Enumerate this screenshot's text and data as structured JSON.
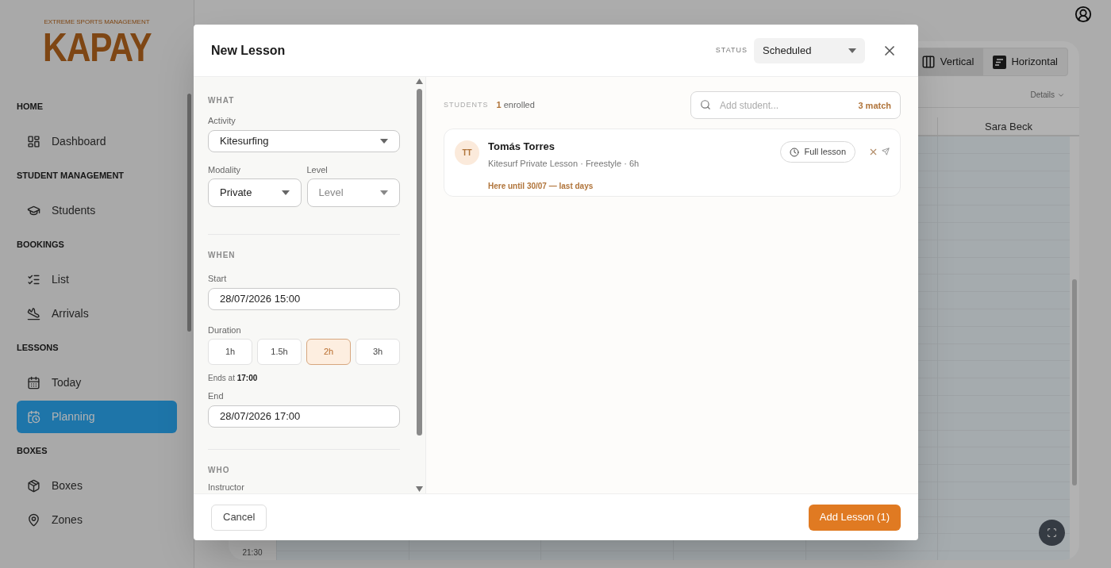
{
  "logo": {
    "tagline": "EXTREME SPORTS MANAGEMENT",
    "name": "KAPAY"
  },
  "sidebar": {
    "sections": [
      {
        "title": "HOME",
        "items": [
          {
            "label": "Dashboard",
            "selected": false
          }
        ]
      },
      {
        "title": "STUDENT MANAGEMENT",
        "items": [
          {
            "label": "Students",
            "selected": false
          }
        ]
      },
      {
        "title": "BOOKINGS",
        "items": [
          {
            "label": "List",
            "selected": false
          },
          {
            "label": "Arrivals",
            "selected": false
          }
        ]
      },
      {
        "title": "LESSONS",
        "items": [
          {
            "label": "Today",
            "selected": false
          },
          {
            "label": "Planning",
            "selected": true
          }
        ]
      },
      {
        "title": "BOXES",
        "items": [
          {
            "label": "Boxes",
            "selected": false
          },
          {
            "label": "Zones",
            "selected": false
          }
        ]
      }
    ]
  },
  "calendar": {
    "views": [
      {
        "label": "Vertical",
        "selected": true
      },
      {
        "label": "Horizontal",
        "selected": false
      }
    ],
    "details": "Details",
    "column_header": "Sara Beck",
    "time_label": "21:30"
  },
  "dialog": {
    "title": "New Lesson",
    "status_label": "STATUS",
    "status": "Scheduled",
    "what": {
      "heading": "WHAT",
      "activity_label": "Activity",
      "activity": "Kitesurfing",
      "modality_label": "Modality",
      "modality": "Private",
      "level_label": "Level",
      "level_placeholder": "Level"
    },
    "when": {
      "heading": "WHEN",
      "start_label": "Start",
      "start": "28/07/2026 15:00",
      "duration_label": "Duration",
      "durations": [
        {
          "label": "1h",
          "selected": false
        },
        {
          "label": "1.5h",
          "selected": false
        },
        {
          "label": "2h",
          "selected": true
        },
        {
          "label": "3h",
          "selected": false
        }
      ],
      "ends_at": "Ends at **17:00**",
      "end_label": "End",
      "end": "28/07/2026 17:00"
    },
    "who": {
      "heading": "WHO",
      "instructor_label": "Instructor"
    },
    "students": {
      "label": "STUDENTS",
      "enrolled": "**1** enrolled",
      "search_placeholder": "Add student...",
      "match": "3 match",
      "items": [
        {
          "initials": "TT",
          "name": "Tomás Torres",
          "details": "Kitesurf Private Lesson · Freestyle · 6h",
          "note": "Here until 30/07 — last days",
          "button": "Full lesson"
        }
      ]
    },
    "cancel": "Cancel",
    "submit": "Add Lesson (1)"
  }
}
